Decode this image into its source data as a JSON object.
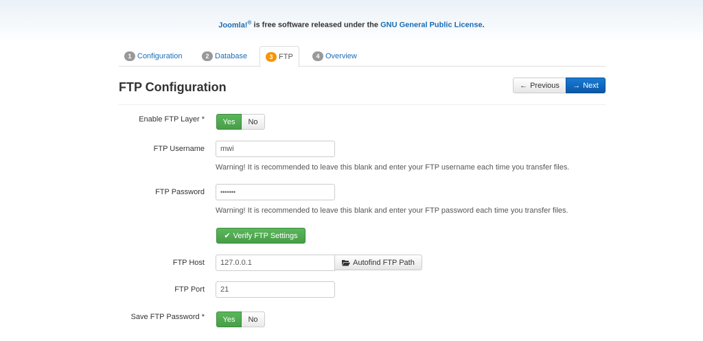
{
  "header": {
    "brand": "Joomla!",
    "brand_mark": "®",
    "license_middle": " is free software released under the ",
    "license_link": "GNU General Public License",
    "license_end": "."
  },
  "tabs": [
    {
      "num": "1",
      "label": "Configuration"
    },
    {
      "num": "2",
      "label": "Database"
    },
    {
      "num": "3",
      "label": "FTP"
    },
    {
      "num": "4",
      "label": "Overview"
    }
  ],
  "page": {
    "title": "FTP Configuration",
    "previous_label": "Previous",
    "next_label": "Next"
  },
  "form": {
    "enable_ftp": {
      "label": "Enable FTP Layer *",
      "yes": "Yes",
      "no": "No"
    },
    "username": {
      "label": "FTP Username",
      "value": "mwi",
      "warning": "Warning! It is recommended to leave this blank and enter your FTP username each time you transfer files."
    },
    "password": {
      "label": "FTP Password",
      "value": "•••••••",
      "warning": "Warning! It is recommended to leave this blank and enter your FTP password each time you transfer files."
    },
    "verify_label": "Verify FTP Settings",
    "host": {
      "label": "FTP Host",
      "value": "127.0.0.1",
      "autofind_label": "Autofind FTP Path"
    },
    "port": {
      "label": "FTP Port",
      "value": "21"
    },
    "save_password": {
      "label": "Save FTP Password *",
      "yes": "Yes",
      "no": "No"
    }
  },
  "colors": {
    "link": "#1a6bb4",
    "active_badge": "#f89406",
    "success": "#5bb75b",
    "primary": "#0a58a8"
  }
}
